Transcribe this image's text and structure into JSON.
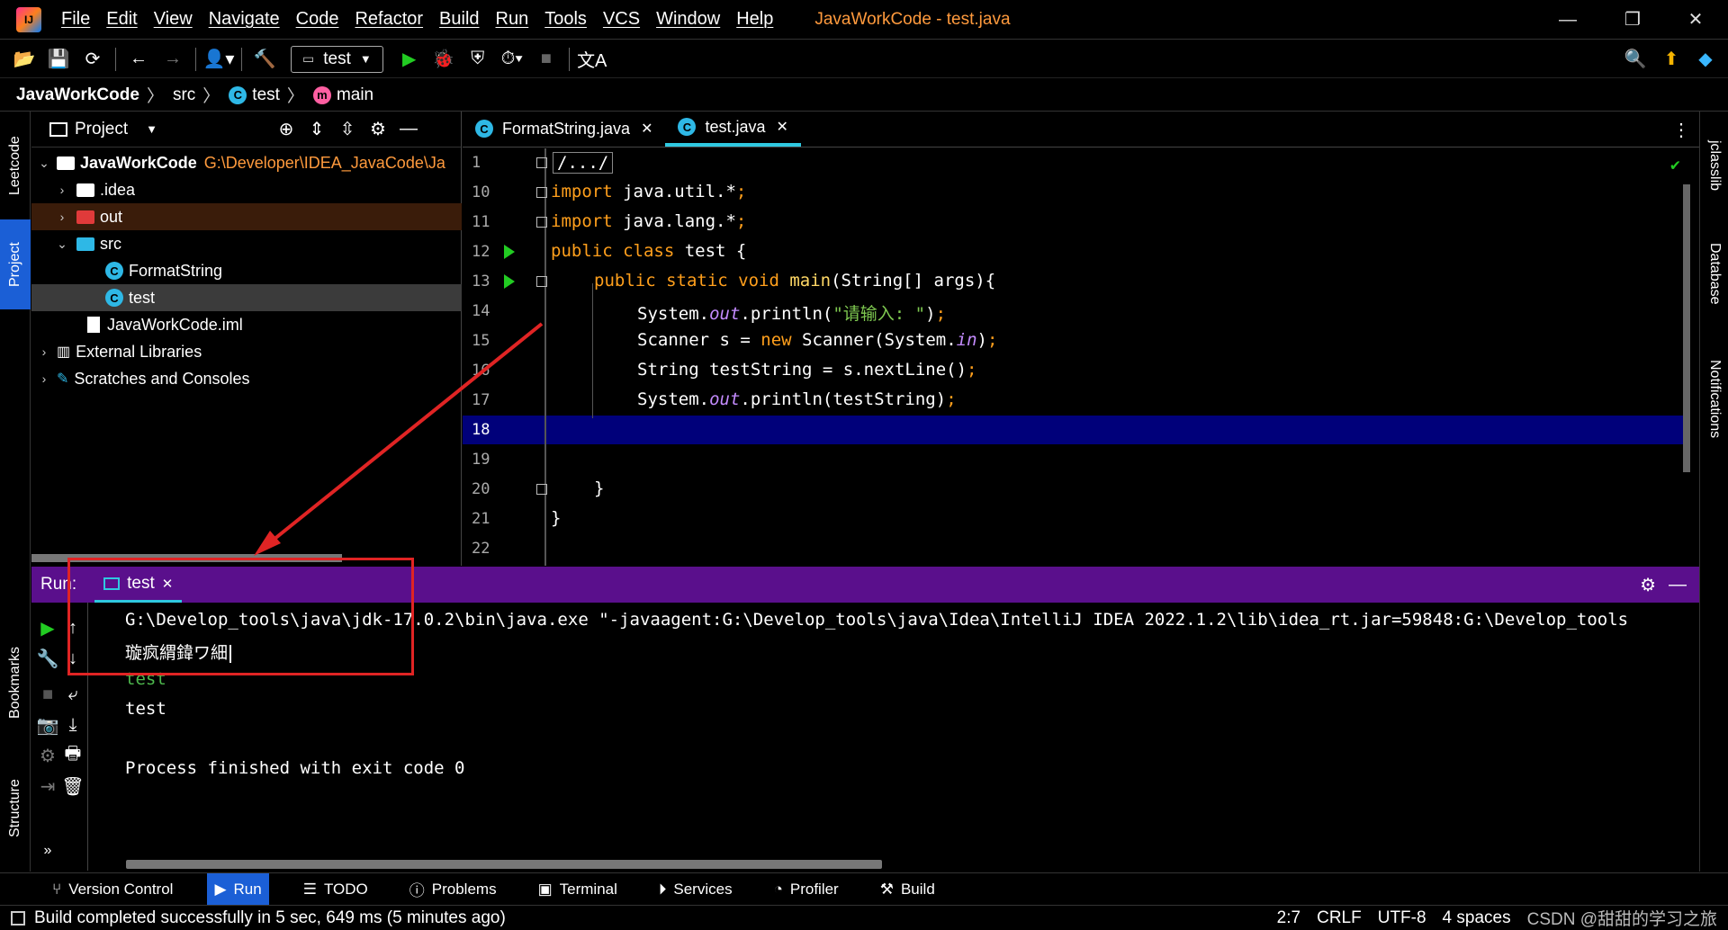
{
  "app": {
    "window_title": "JavaWorkCode - test.java"
  },
  "menu": [
    "File",
    "Edit",
    "View",
    "Navigate",
    "Code",
    "Refactor",
    "Build",
    "Run",
    "Tools",
    "VCS",
    "Window",
    "Help"
  ],
  "toolbar": {
    "run_config": "test"
  },
  "breadcrumb": {
    "project": "JavaWorkCode",
    "src": "src",
    "file": "test",
    "method": "main"
  },
  "left_stripe": {
    "leetcode": "Leetcode",
    "project": "Project",
    "bookmarks": "Bookmarks",
    "structure": "Structure"
  },
  "right_stripe": {
    "jclasslib": "jclasslib",
    "database": "Database",
    "notifications": "Notifications"
  },
  "project_panel": {
    "title": "Project",
    "root_name": "JavaWorkCode",
    "root_path": "G:\\Developer\\IDEA_JavaCode\\Ja",
    "items": [
      {
        "label": ".idea"
      },
      {
        "label": "out"
      },
      {
        "label": "src"
      },
      {
        "label": "FormatString"
      },
      {
        "label": "test"
      },
      {
        "label": "JavaWorkCode.iml"
      },
      {
        "label": "External Libraries"
      },
      {
        "label": "Scratches and Consoles"
      }
    ]
  },
  "editor": {
    "tabs": [
      {
        "label": "FormatString.java"
      },
      {
        "label": "test.java"
      }
    ],
    "line_numbers": [
      "1",
      "10",
      "11",
      "12",
      "13",
      "14",
      "15",
      "16",
      "17",
      "18",
      "19",
      "20",
      "21",
      "22"
    ],
    "code": {
      "l1": "/.../",
      "l10_kw": "import",
      "l10_rest": " java.util.*",
      "l10_sc": ";",
      "l11_kw": "import",
      "l11_rest": " java.lang.*",
      "l11_sc": ";",
      "l12_kw": "public class",
      "l12_rest": " test {",
      "l13_kw": "public static void",
      "l13_name": " main",
      "l13_rest": "(String[] args){",
      "l14_a": "System.",
      "l14_b": "out",
      "l14_c": ".println(",
      "l14_str": "\"请输入: \"",
      "l14_d": ")",
      "l14_sc": ";",
      "l15_a": "Scanner s = ",
      "l15_kw": "new",
      "l15_b": " Scanner(System.",
      "l15_c": "in",
      "l15_d": ")",
      "l15_sc": ";",
      "l16_a": "String testString = s.nextLine()",
      "l16_sc": ";",
      "l17_a": "System.",
      "l17_b": "out",
      "l17_c": ".println(testString)",
      "l17_sc": ";",
      "l20": "}",
      "l21": "}"
    }
  },
  "run_panel": {
    "label": "Run:",
    "tab": "test",
    "lines": {
      "cmd": "G:\\Develop_tools\\java\\jdk-17.0.2\\bin\\java.exe \"-javaagent:G:\\Develop_tools\\java\\Idea\\IntelliJ IDEA 2022.1.2\\lib\\idea_rt.jar=59848:G:\\Develop_tools",
      "garbled": "璇疯緭鍏ワ細",
      "input": "test",
      "output": "test",
      "finish": "Process finished with exit code 0"
    }
  },
  "bottom_tools": [
    "Version Control",
    "Run",
    "TODO",
    "Problems",
    "Terminal",
    "Services",
    "Profiler",
    "Build"
  ],
  "status": {
    "message": "Build completed successfully in 5 sec, 649 ms (5 minutes ago)",
    "position": "2:7",
    "line_sep": "CRLF",
    "encoding": "UTF-8",
    "indent": "4 spaces",
    "watermark": "CSDN @甜甜的学习之旅"
  },
  "colors": {
    "accent": "#2fc8e0",
    "run_header": "#5a0f8c",
    "current_line": "#00007a",
    "keyword": "#ff9f1c",
    "annotation_box": "#e02424"
  }
}
